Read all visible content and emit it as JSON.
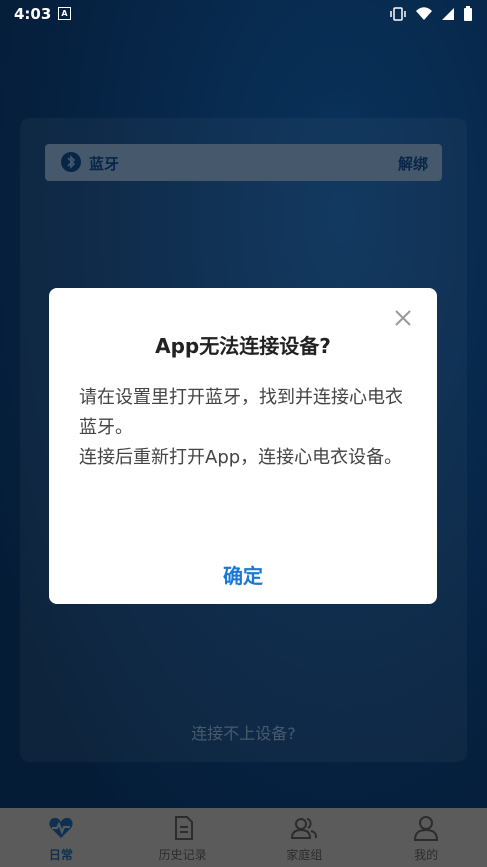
{
  "status_bar": {
    "time": "4:03",
    "a_label": "A"
  },
  "bluetooth": {
    "label": "蓝牙",
    "unbind": "解绑"
  },
  "cant_connect": "连接不上设备?",
  "dialog": {
    "title": "App无法连接设备?",
    "message": "请在设置里打开蓝牙，找到并连接心电衣蓝牙。\n 连接后重新打开App，连接心电衣设备。",
    "ok": "确定"
  },
  "tabs": [
    {
      "label": "日常",
      "icon": "heart-pulse-icon"
    },
    {
      "label": "历史记录",
      "icon": "document-icon"
    },
    {
      "label": "家庭组",
      "icon": "group-icon"
    },
    {
      "label": "我的",
      "icon": "user-icon"
    }
  ],
  "colors": {
    "accent": "#1a78d6",
    "dark_blue": "#0b3a6e"
  }
}
